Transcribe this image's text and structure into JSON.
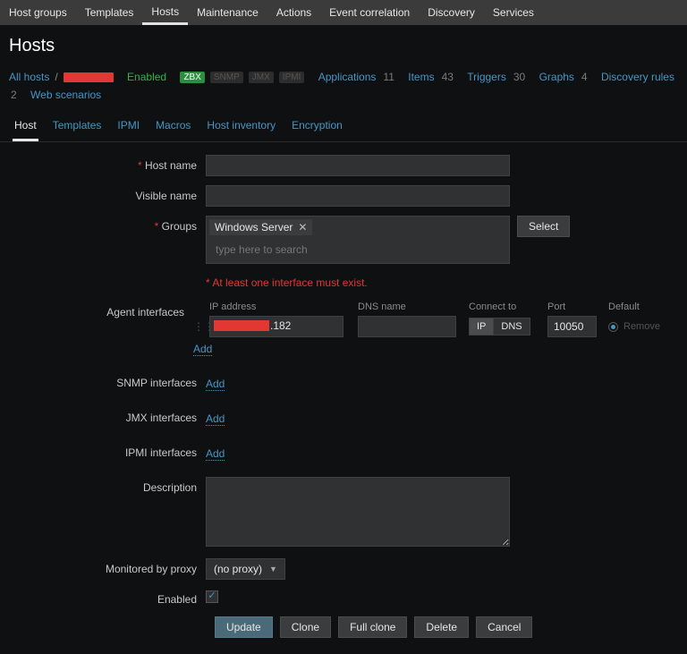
{
  "topnav": {
    "items": [
      "Host groups",
      "Templates",
      "Hosts",
      "Maintenance",
      "Actions",
      "Event correlation",
      "Discovery",
      "Services"
    ],
    "active": 2
  },
  "page_title": "Hosts",
  "crumbs": {
    "all_hosts": "All hosts",
    "enabled": "Enabled",
    "badges": {
      "zbx": "ZBX",
      "snmp": "SNMP",
      "jmx": "JMX",
      "ipmi": "IPMI"
    },
    "links": [
      {
        "label": "Applications",
        "count": "11"
      },
      {
        "label": "Items",
        "count": "43"
      },
      {
        "label": "Triggers",
        "count": "30"
      },
      {
        "label": "Graphs",
        "count": "4"
      },
      {
        "label": "Discovery rules",
        "count": "2"
      },
      {
        "label": "Web scenarios",
        "count": ""
      }
    ]
  },
  "subtabs": {
    "items": [
      "Host",
      "Templates",
      "IPMI",
      "Macros",
      "Host inventory",
      "Encryption"
    ],
    "active": 0
  },
  "form": {
    "labels": {
      "host_name": "Host name",
      "visible_name": "Visible name",
      "groups": "Groups",
      "agent": "Agent interfaces",
      "snmp": "SNMP interfaces",
      "jmx": "JMX interfaces",
      "ipmi": "IPMI interfaces",
      "description": "Description",
      "proxy": "Monitored by proxy",
      "enabled": "Enabled"
    },
    "host_name_value": "",
    "visible_name_value": "",
    "group_tag": "Windows Server",
    "group_placeholder": "type here to search",
    "select_btn": "Select",
    "iface_warn": "At least one interface must exist.",
    "iface_head": {
      "ip": "IP address",
      "dns": "DNS name",
      "connect": "Connect to",
      "port": "Port",
      "default": "Default"
    },
    "iface_row": {
      "ip_suffix": ".182",
      "dns": "",
      "conn_ip": "IP",
      "conn_dns": "DNS",
      "port": "10050",
      "remove": "Remove"
    },
    "add": "Add",
    "description_value": "",
    "proxy_value": "(no proxy)",
    "enabled_checked": true,
    "buttons": {
      "update": "Update",
      "clone": "Clone",
      "full_clone": "Full clone",
      "delete": "Delete",
      "cancel": "Cancel"
    }
  }
}
